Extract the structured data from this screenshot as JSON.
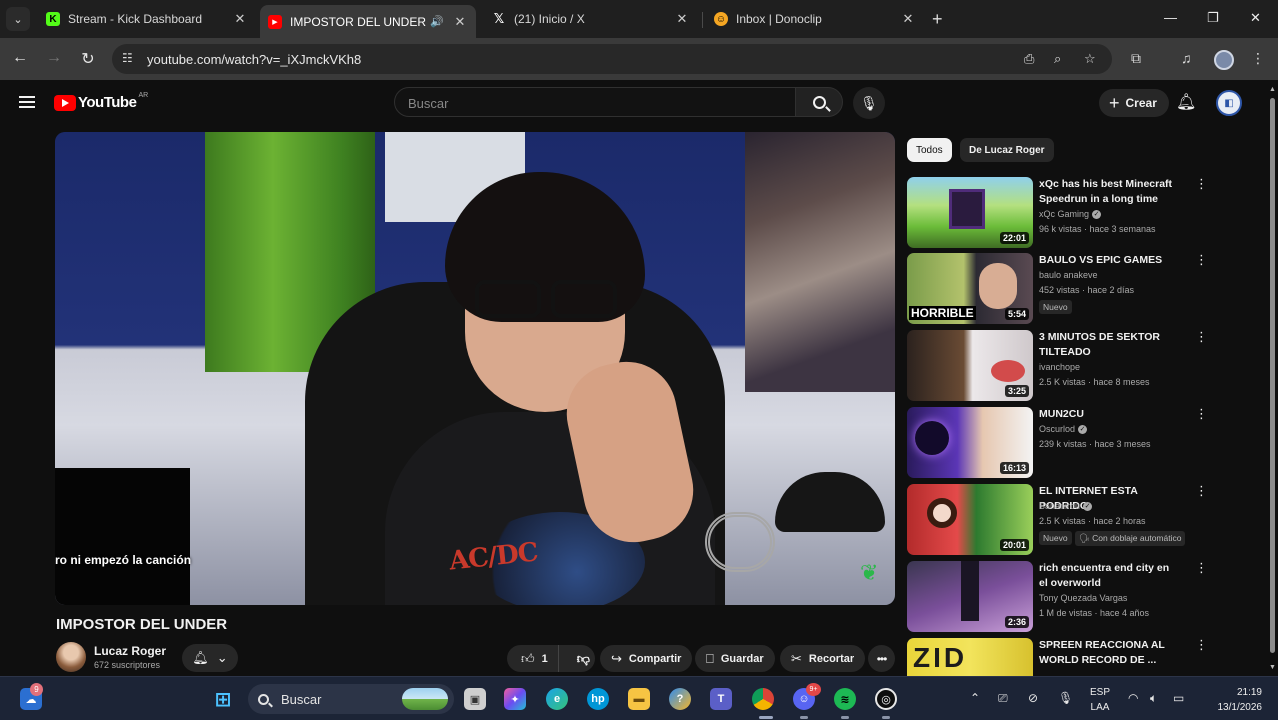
{
  "browser": {
    "tabs": [
      {
        "title": "Stream - Kick Dashboard",
        "favicon": "kick-icon"
      },
      {
        "title": "IMPOSTOR DEL UNDER - Yo",
        "favicon": "youtube-icon",
        "active": true,
        "audio": "speaker-icon"
      },
      {
        "title": "(21) Inicio / X",
        "favicon": "x-icon"
      },
      {
        "title": "Inbox | Donoclip",
        "favicon": "donoclip-icon"
      }
    ],
    "url": "youtube.com/watch?v=_iXJmckVKh8"
  },
  "youtube": {
    "logo_text": "YouTube",
    "country": "AR",
    "search_placeholder": "Buscar",
    "create_label": "Crear"
  },
  "video": {
    "title": "IMPOSTOR DEL UNDER",
    "subtitle_overlay": "ro ni empezó la canción",
    "shirt_text": "AC/DC",
    "channel_name": "Lucaz Roger",
    "subscribers": "672 suscriptores",
    "likes": "1",
    "actions": {
      "share": "Compartir",
      "save": "Guardar",
      "clip": "Recortar"
    }
  },
  "filters": [
    "Todos",
    "De Lucaz Roger"
  ],
  "recommendations": [
    {
      "title": "xQc has his best Minecraft Speedrun in a long time",
      "channel": "xQc Gaming",
      "verified": true,
      "stats": "96 k vistas · hace 3 semanas",
      "duration": "22:01"
    },
    {
      "title": "BAULO VS EPIC GAMES",
      "channel": "baulo anakeve",
      "verified": false,
      "stats": "452 vistas · hace 2 días",
      "duration": "5:54",
      "badge": "Nuevo",
      "thumb_text": "HORRIBLE"
    },
    {
      "title": "3 MINUTOS DE SEKTOR TILTEADO",
      "channel": "ivanchope",
      "verified": false,
      "stats": "2.5 K vistas · hace 8 meses",
      "duration": "3:25"
    },
    {
      "title": "MUN2CU",
      "channel": "Oscurlod",
      "verified": true,
      "stats": "239 k vistas · hace 3 meses",
      "duration": "16:13"
    },
    {
      "title": "EL INTERNET ESTA PODRIDO",
      "channel": "Bananirou",
      "verified": true,
      "stats": "2.5 K vistas · hace 2 horas",
      "duration": "20:01",
      "badge": "Nuevo",
      "badge2": "Con doblaje automático"
    },
    {
      "title": "rich encuentra end city en el overworld",
      "channel": "Tony Quezada Vargas",
      "verified": false,
      "stats": "1 M de vistas · hace 4 años",
      "duration": "2:36"
    },
    {
      "title": "SPREEN REACCIONA AL WORLD RECORD DE ...",
      "channel": "",
      "verified": false,
      "stats": "",
      "duration": "",
      "thumb_text": "ZID"
    }
  ],
  "taskbar": {
    "search_placeholder": "Buscar",
    "widget_badge": "9",
    "discord_badge": "9+",
    "language_line1": "ESP",
    "language_line2": "LAA",
    "time": "21:19",
    "date": "13/1/2026"
  }
}
